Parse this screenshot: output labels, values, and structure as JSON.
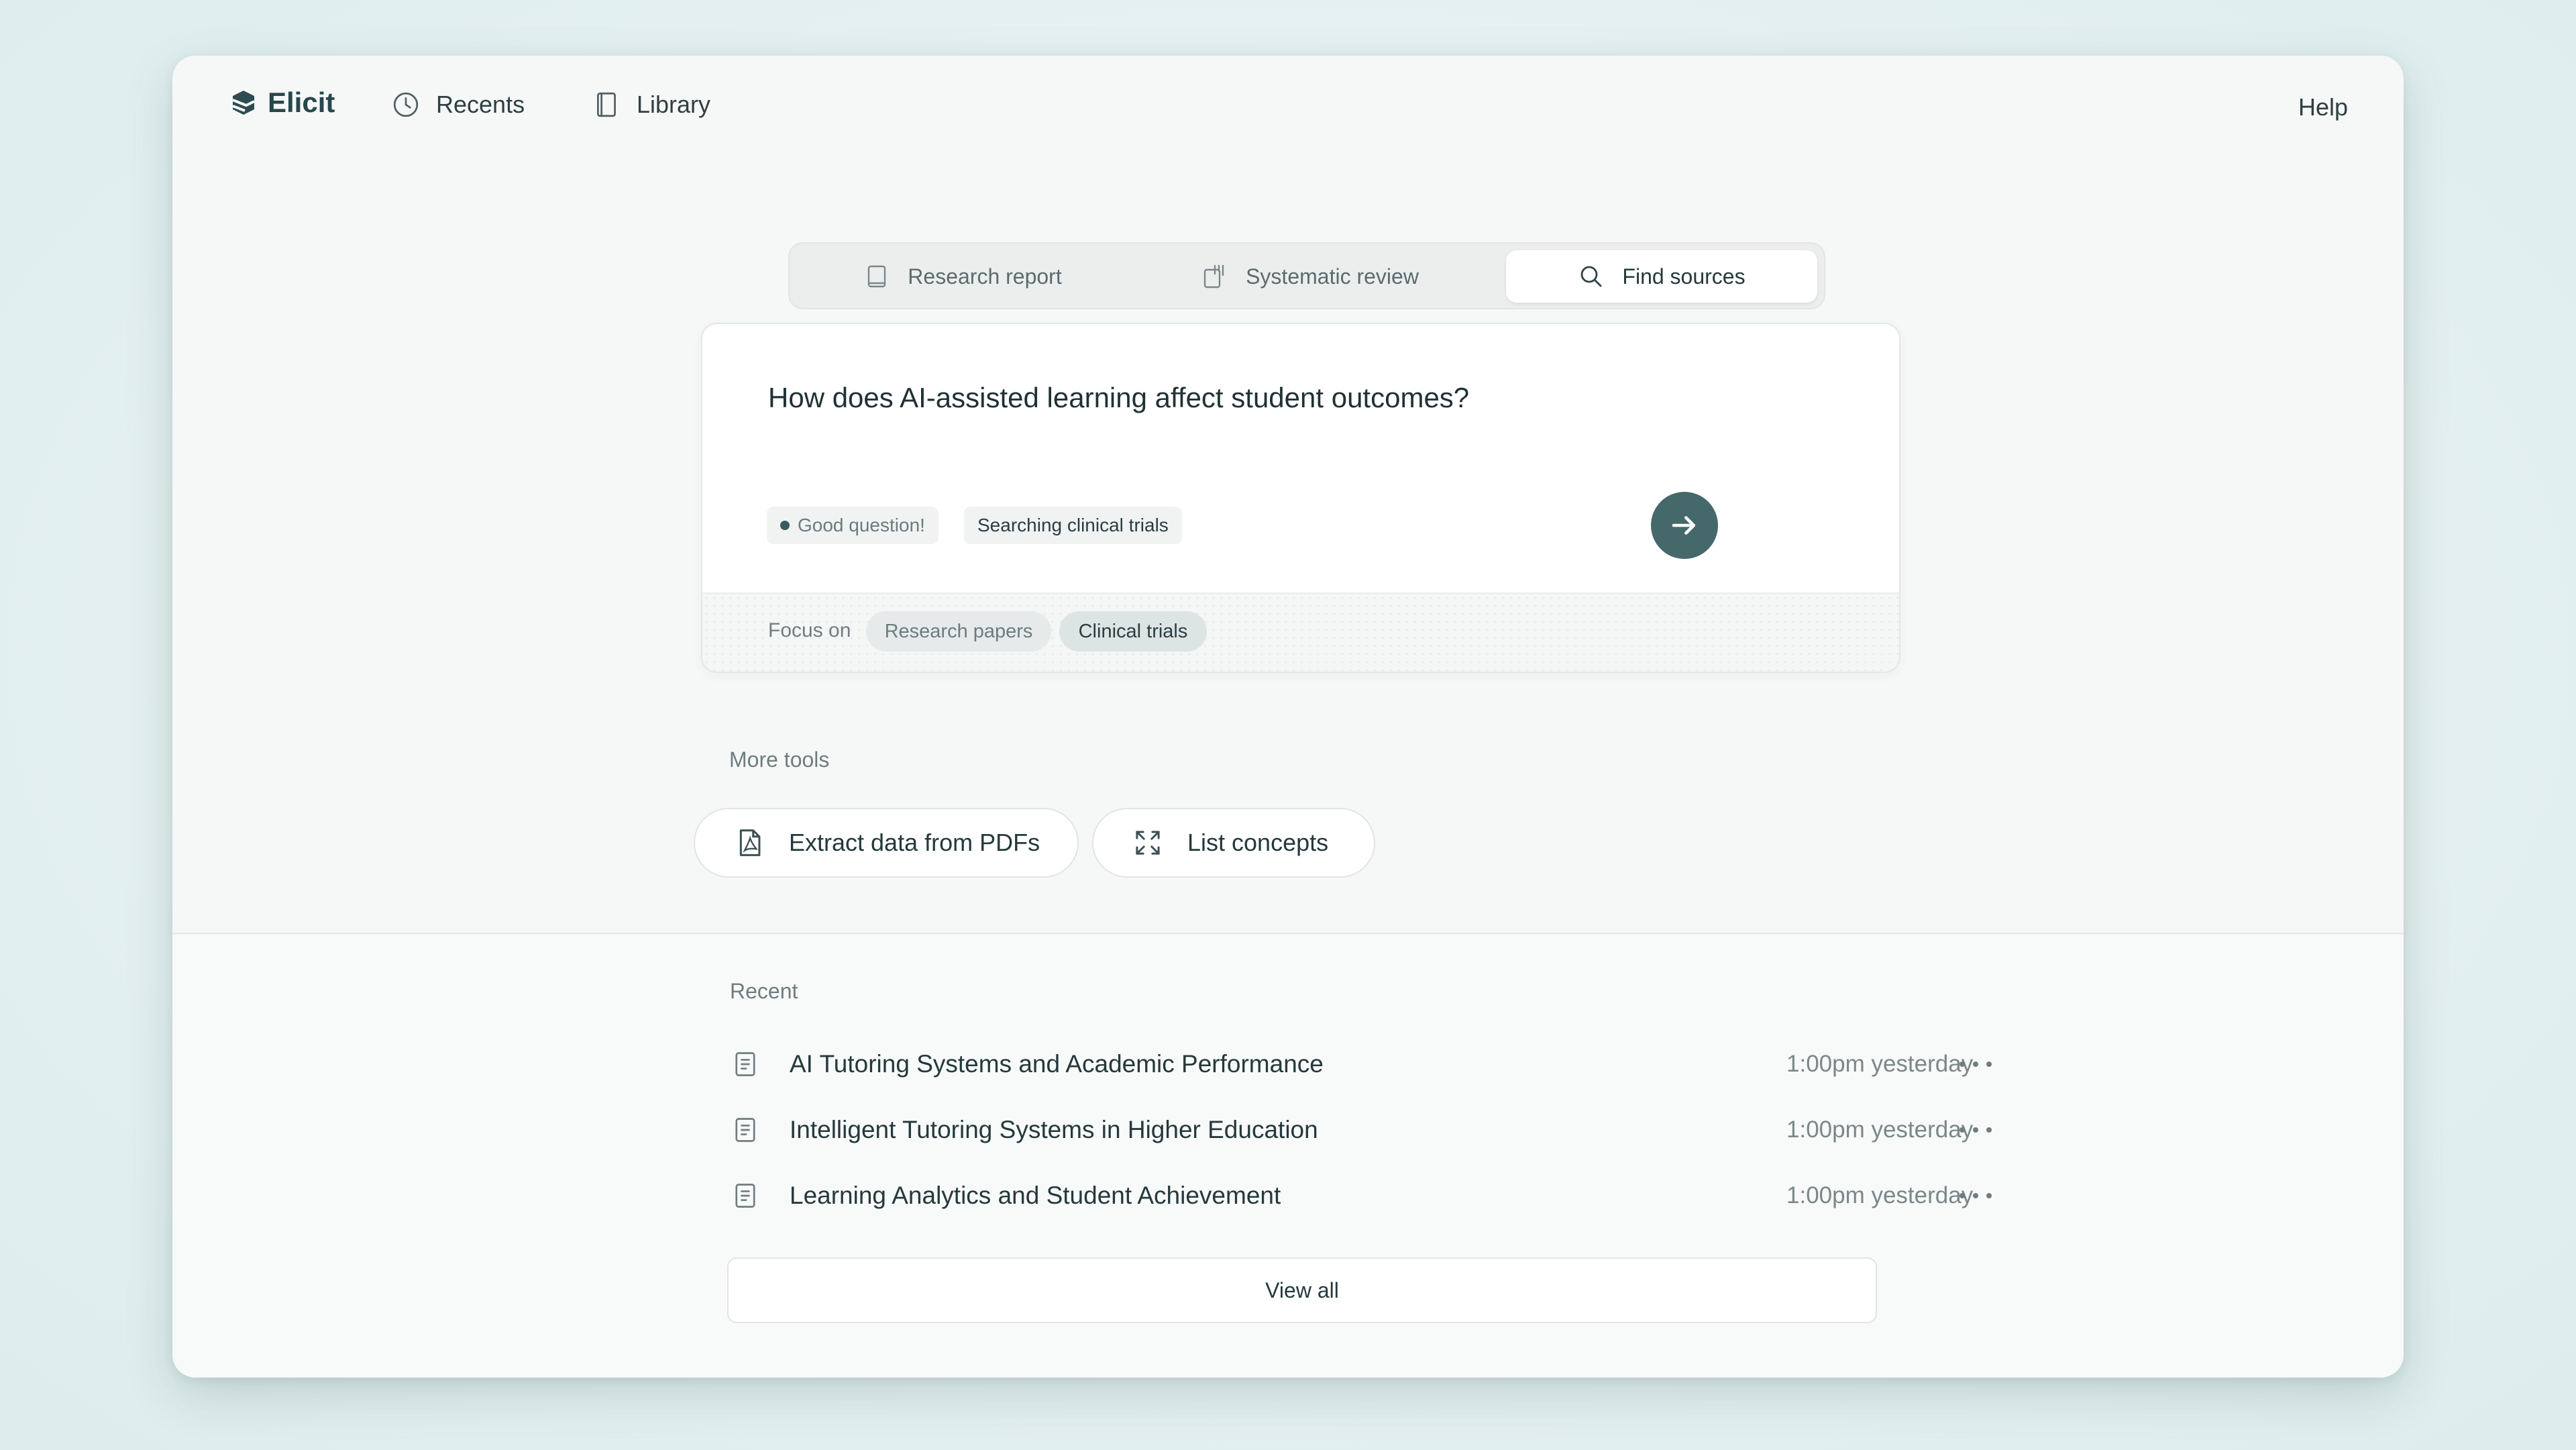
{
  "nav": {
    "brand": "Elicit",
    "recents_label": "Recents",
    "library_label": "Library",
    "help_label": "Help"
  },
  "modes": [
    {
      "label": "Research report",
      "icon": "report-icon",
      "active": false
    },
    {
      "label": "Systematic review",
      "icon": "review-icon",
      "active": false
    },
    {
      "label": "Find sources",
      "icon": "search-icon",
      "active": true
    }
  ],
  "query": {
    "text": "How does AI-assisted learning affect student outcomes?",
    "status_chip": "Good question!",
    "searching_chip": "Searching clinical trials",
    "focus_label": "Focus on",
    "focus_options": [
      {
        "label": "Research papers",
        "selected": false
      },
      {
        "label": "Clinical trials",
        "selected": true
      }
    ]
  },
  "more_tools": {
    "label": "More tools",
    "tools": [
      {
        "label": "Extract data from PDFs",
        "icon": "pdf-icon"
      },
      {
        "label": "List concepts",
        "icon": "expand-icon"
      }
    ]
  },
  "recent": {
    "label": "Recent",
    "items": [
      {
        "title": "AI Tutoring Systems and Academic Performance",
        "time": "1:00pm yesterday"
      },
      {
        "title": "Intelligent Tutoring Systems in Higher Education",
        "time": "1:00pm yesterday"
      },
      {
        "title": "Learning Analytics and Student Achievement",
        "time": "1:00pm yesterday"
      }
    ],
    "view_all_label": "View all"
  },
  "colors": {
    "accent": "#45686b",
    "background": "#e5f0f0",
    "panel": "#f6f7f7"
  }
}
